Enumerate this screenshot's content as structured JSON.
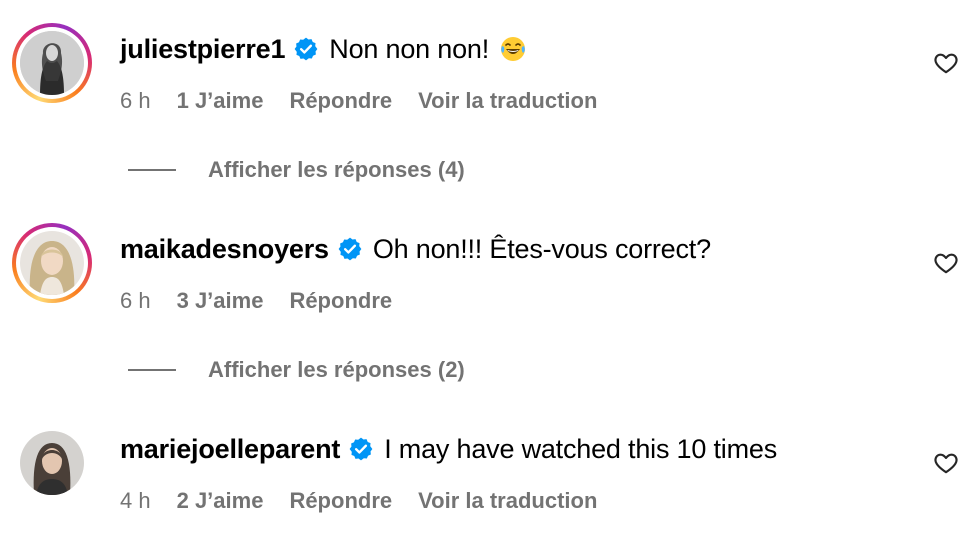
{
  "comments": [
    {
      "username": "juliestpierre1",
      "verified": true,
      "text": "Non non non!",
      "emoji": "face-with-tears-of-joy",
      "time": "6 h",
      "likes": "1 J’aime",
      "reply": "Répondre",
      "translate": "Voir la traduction",
      "story_ring": true
    },
    {
      "username": "maikadesnoyers",
      "verified": true,
      "text": "Oh non!!! Êtes-vous correct?",
      "time": "6 h",
      "likes": "3 J’aime",
      "reply": "Répondre",
      "story_ring": true
    },
    {
      "username": "mariejoelleparent",
      "verified": true,
      "text": "I may have watched this 10 times",
      "time": "4 h",
      "likes": "2 J’aime",
      "reply": "Répondre",
      "translate": "Voir la traduction",
      "story_ring": false
    }
  ],
  "reply_threads": [
    {
      "label": "Afficher les réponses (4)"
    },
    {
      "label": "Afficher les réponses (2)"
    }
  ],
  "icons": {
    "verified": "verified-badge-icon",
    "like": "heart-icon",
    "emoji": "laughing-emoji-icon"
  },
  "colors": {
    "verified_blue": "#0095f6",
    "secondary_text": "#737373",
    "primary_text": "#000000"
  }
}
